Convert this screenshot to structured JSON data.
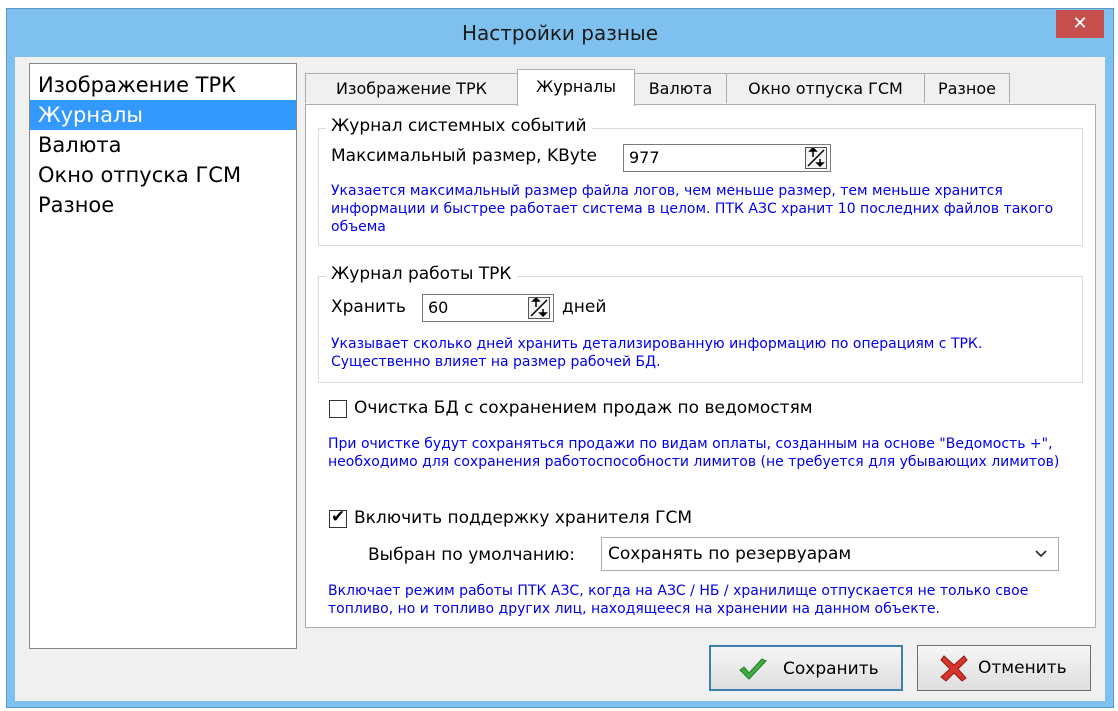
{
  "window": {
    "title": "Настройки разные",
    "close_glyph": "✕"
  },
  "sidebar": {
    "items": [
      "Изображение ТРК",
      "Журналы",
      "Валюта",
      "Окно отпуска ГСМ",
      "Разное"
    ],
    "selected": "Журналы"
  },
  "tabs": {
    "items": [
      "Изображение ТРК",
      "Журналы",
      "Валюта",
      "Окно отпуска ГСМ",
      "Разное"
    ],
    "active": "Журналы"
  },
  "system_log": {
    "title": "Журнал системных событий",
    "max_size_label": "Максимальный размер, KByte",
    "max_size_value": "977",
    "note": "Указается максимальный размер файла логов, чем меньше размер, тем меньше хранится информации и быстрее работает система в целом. ПТК АЗС хранит 10 последних файлов такого объема"
  },
  "pump_log": {
    "title": "Журнал работы ТРК",
    "keep_label": "Хранить",
    "keep_value": "60",
    "days_label": "дней",
    "note": "Указывает сколько дней хранить детализированную информацию по операциям с ТРК. Существенно влияет на размер рабочей БД."
  },
  "cleanup": {
    "label": "Очистка БД с сохранением продаж по ведомостям",
    "checked": false,
    "note": "При очистке будут сохраняться продажи по видам оплаты, созданным на  основе \"Ведомость +\", необходимо для сохранения работоспособности лимитов (не требуется для убывающих лимитов)"
  },
  "storage": {
    "label": "Включить поддержку хранителя ГСМ",
    "checked": true,
    "check_glyph": "✔",
    "default_label": "Выбран по умолчанию:",
    "default_value": "Сохранять по резервуарам",
    "note": "Включает режим работы ПТК АЗС, когда на АЗС / НБ / хранилище отпускается не только свое топливо, но и топливо других лиц, находящееся на хранении на данном объекте."
  },
  "buttons": {
    "save": "Сохранить",
    "cancel": "Отменить"
  },
  "colors": {
    "titlebar": "#7ec0ee",
    "selection": "#3399ff",
    "note_text": "#0000ee",
    "close": "#c7504f"
  }
}
